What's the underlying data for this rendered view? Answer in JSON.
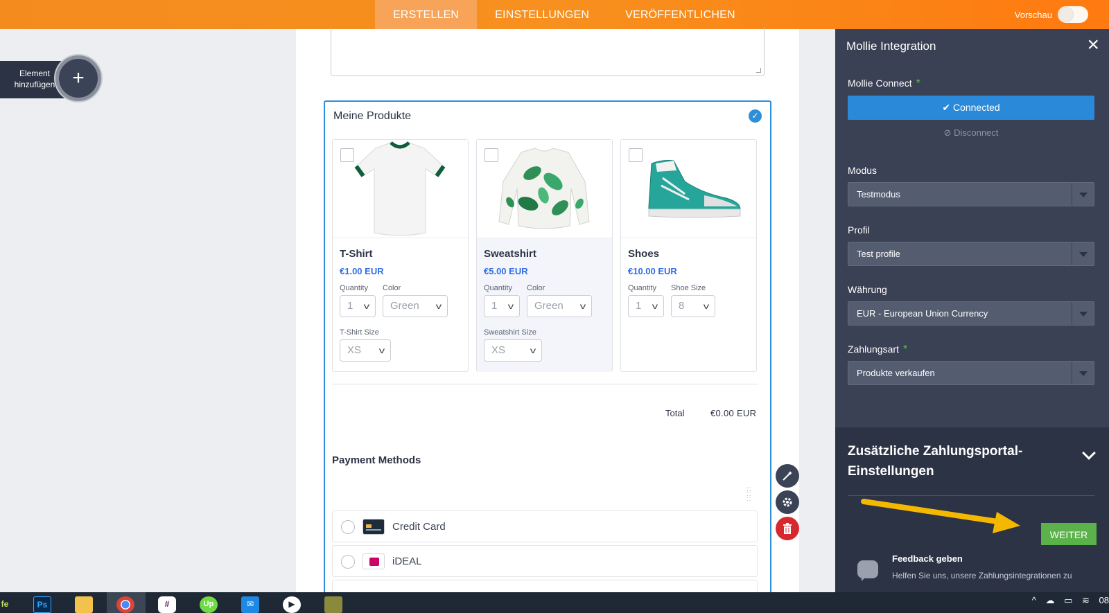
{
  "topbar": {
    "tabs": [
      "ERSTELLEN",
      "EINSTELLUNGEN",
      "VERÖFFENTLICHEN"
    ],
    "preview_label": "Vorschau"
  },
  "left": {
    "add_element_label": "Element hinzufügen",
    "add_symbol": "+"
  },
  "form": {
    "block_title": "Meine Produkte",
    "products": [
      {
        "name": "T-Shirt",
        "price": "€1.00 EUR",
        "quantity_label": "Quantity",
        "quantity": "1",
        "option1_label": "Color",
        "option1_value": "Green",
        "option2_label": "T-Shirt Size",
        "option2_value": "XS"
      },
      {
        "name": "Sweatshirt",
        "price": "€5.00 EUR",
        "quantity_label": "Quantity",
        "quantity": "1",
        "option1_label": "Color",
        "option1_value": "Green",
        "option2_label": "Sweatshirt Size",
        "option2_value": "XS"
      },
      {
        "name": "Shoes",
        "price": "€10.00 EUR",
        "quantity_label": "Quantity",
        "quantity": "1",
        "option1_label": "Shoe Size",
        "option1_value": "8"
      }
    ],
    "total_label": "Total",
    "total_value": "€0.00 EUR",
    "payment_title": "Payment Methods",
    "payment_methods": [
      "Credit Card",
      "iDEAL"
    ]
  },
  "panel": {
    "title": "Mollie Integration",
    "connect_label": "Mollie Connect",
    "connected_button": "Connected",
    "disconnect_link": "Disconnect",
    "fields": [
      {
        "label": "Modus",
        "value": "Testmodus"
      },
      {
        "label": "Profil",
        "value": "Test profile"
      },
      {
        "label": "Währung",
        "value": "EUR - European Union Currency"
      },
      {
        "label": "Zahlungsart",
        "value": "Produkte verkaufen"
      }
    ],
    "advanced_title": "Zusätzliche Zahlungsportal-Einstellungen",
    "next_button": "WEITER",
    "feedback_title": "Feedback geben",
    "feedback_text": "Helfen Sie uns, unsere Zahlungsintegrationen zu"
  },
  "taskbar": {
    "clock_partial": "08"
  },
  "colors": {
    "topbar": "#f7901e",
    "panel": "#3a4155",
    "accent_blue": "#2b89d9",
    "next_green": "#5cb24a",
    "annotation_arrow": "#f5b800"
  }
}
